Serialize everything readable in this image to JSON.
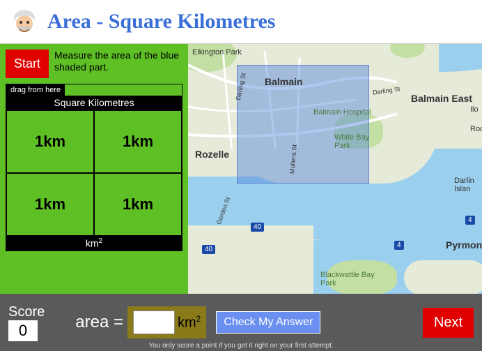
{
  "header": {
    "title": "Area - Square Kilometres"
  },
  "instruction": {
    "start_label": "Start",
    "text": "Measure the area of the blue shaded part."
  },
  "tiles": {
    "drag_label": "drag from here",
    "header": "Square Kilometres",
    "cells": [
      "1km",
      "1km",
      "1km",
      "1km"
    ],
    "footer_value": "",
    "footer_unit": "km",
    "footer_exp": "2"
  },
  "map": {
    "labels": {
      "elkington": "Elkington Park",
      "balmain": "Balmain",
      "balmain_east": "Balmain East",
      "balmain_hospital": "Balmain Hospital",
      "white_bay_park": "White Bay Park",
      "rozelle": "Rozelle",
      "darling_isl": "Darlin Islan",
      "pyrmont": "Pyrmont",
      "blackwattle": "Blackwattle Bay Park",
      "ilo": "Ilo",
      "roc": "Roc",
      "darling_st": "Darling St",
      "darling_st2": "Darling St",
      "mullens": "Mullens St",
      "gordon": "Gordon St"
    },
    "routes": [
      "40",
      "40",
      "4",
      "4"
    ]
  },
  "footer": {
    "score_label": "Score",
    "score_value": "0",
    "area_label": "area =",
    "area_value": "",
    "area_unit": "km",
    "area_exp": "2",
    "check_label": "Check My Answer",
    "next_label": "Next",
    "hint": "You only score a point if you get it right on your first attempt."
  }
}
